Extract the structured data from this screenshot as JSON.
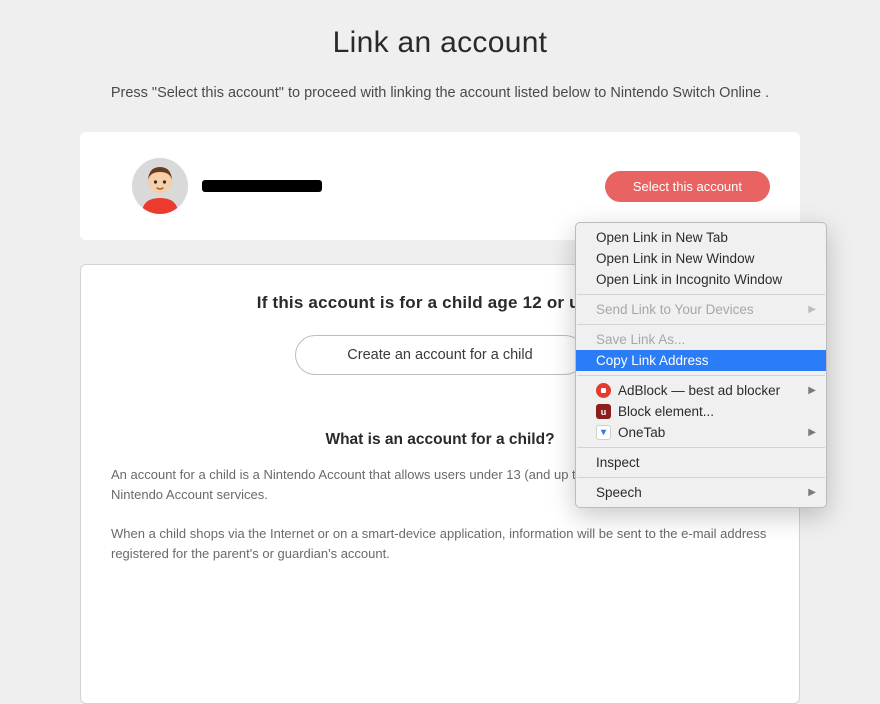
{
  "page": {
    "title": "Link an account",
    "subtitle": "Press \"Select this account\" to proceed with linking the account listed below to Nintendo Switch Online ."
  },
  "account": {
    "name_redacted": "",
    "select_btn": "Select this account"
  },
  "child": {
    "heading": "If this account is for a child age 12 or under:",
    "create_btn": "Create an account for a child",
    "faq_heading": "What is an account for a child?",
    "para1": "An account for a child is a Nintendo Account that allows users under 13 (and up to 17) years of age to use Nintendo Account services.",
    "para2": "When a child shops via the Internet or on a smart-device application, information will be sent to the e-mail address registered for the parent's or guardian's account."
  },
  "context_menu": {
    "items": [
      {
        "label": "Open Link in New Tab",
        "enabled": true
      },
      {
        "label": "Open Link in New Window",
        "enabled": true
      },
      {
        "label": "Open Link in Incognito Window",
        "enabled": true
      },
      {
        "sep": true
      },
      {
        "label": "Send Link to Your Devices",
        "enabled": false,
        "submenu": true
      },
      {
        "sep": true
      },
      {
        "label": "Save Link As...",
        "enabled": false
      },
      {
        "label": "Copy Link Address",
        "enabled": true,
        "highlight": true
      },
      {
        "sep": true
      },
      {
        "label": "AdBlock — best ad blocker",
        "enabled": true,
        "submenu": true,
        "icon": "adblock"
      },
      {
        "label": "Block element...",
        "enabled": true,
        "icon": "ublock"
      },
      {
        "label": "OneTab",
        "enabled": true,
        "submenu": true,
        "icon": "onetab"
      },
      {
        "sep": true
      },
      {
        "label": "Inspect",
        "enabled": true
      },
      {
        "sep": true
      },
      {
        "label": "Speech",
        "enabled": true,
        "submenu": true
      }
    ]
  }
}
